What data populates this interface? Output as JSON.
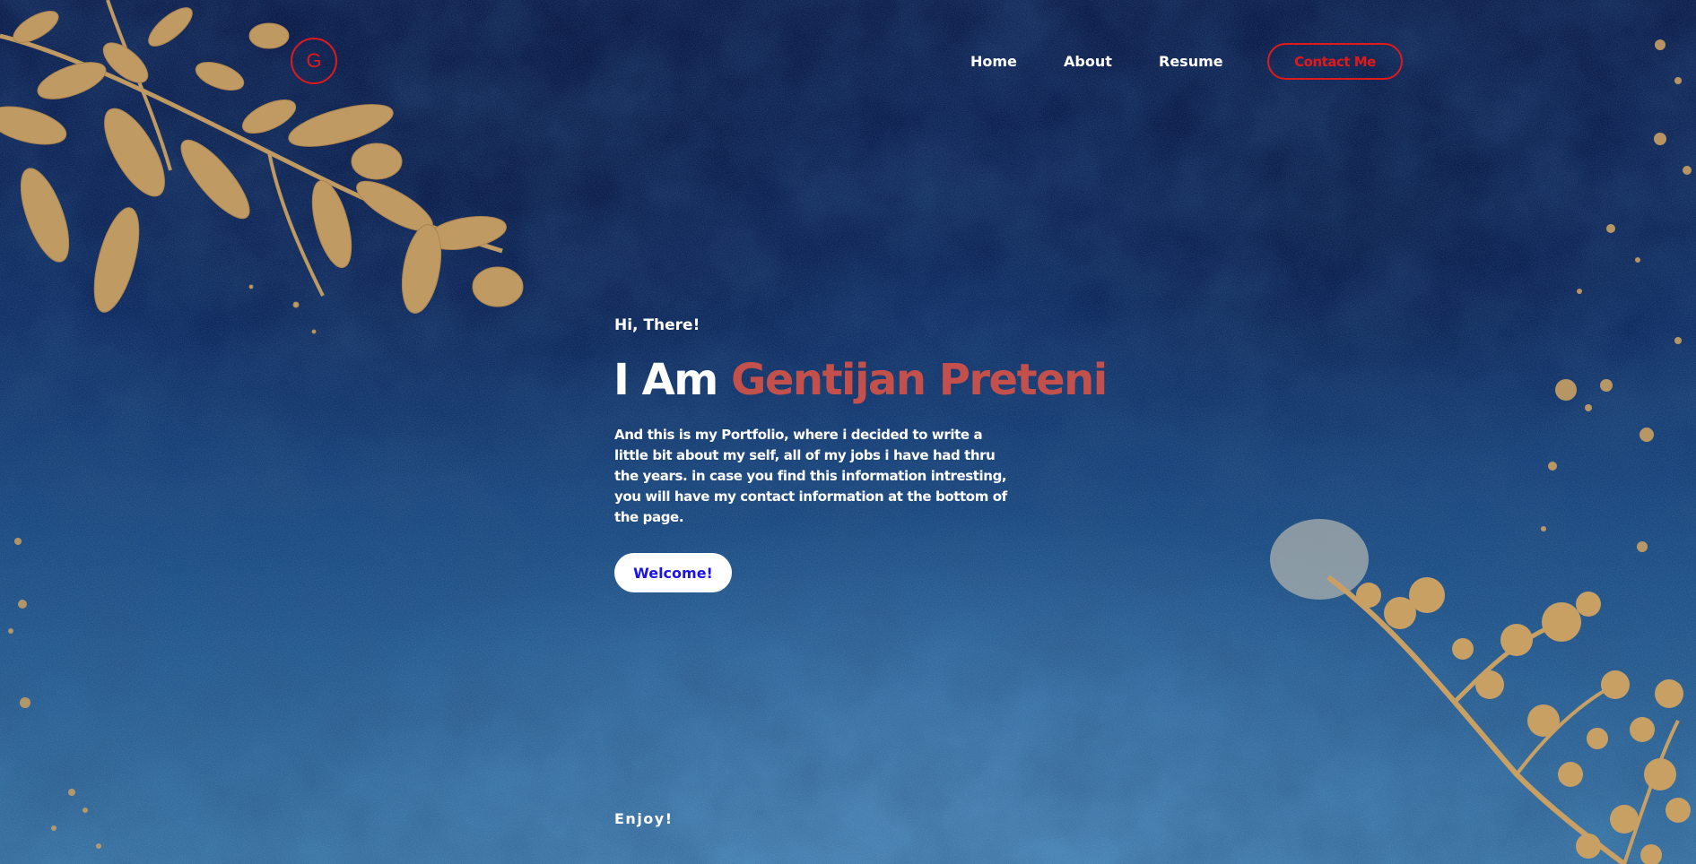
{
  "logo": {
    "letter": "G"
  },
  "nav": {
    "home": "Home",
    "about": "About",
    "resume": "Resume",
    "contact": "Contact Me"
  },
  "hero": {
    "greeting": "Hi, There!",
    "headline_prefix": "I Am",
    "headline_name": "Gentijan Preteni",
    "description": "And this is my Portfolio, where i decided to write a little bit about my self, all of my jobs i have had thru the years. in case you find this information intresting, you will have my contact information at the bottom of the page.",
    "cta": "Welcome!",
    "footer_note": "Enjoy!"
  },
  "colors": {
    "accent_red": "#e0191b",
    "name_red": "#c4504c",
    "cta_text_blue": "#1a14e6",
    "gold": "#c9a063"
  },
  "decorations": {
    "top_left": "gold-leaves-illustration",
    "bottom_right": "gold-berry-branch-illustration"
  }
}
